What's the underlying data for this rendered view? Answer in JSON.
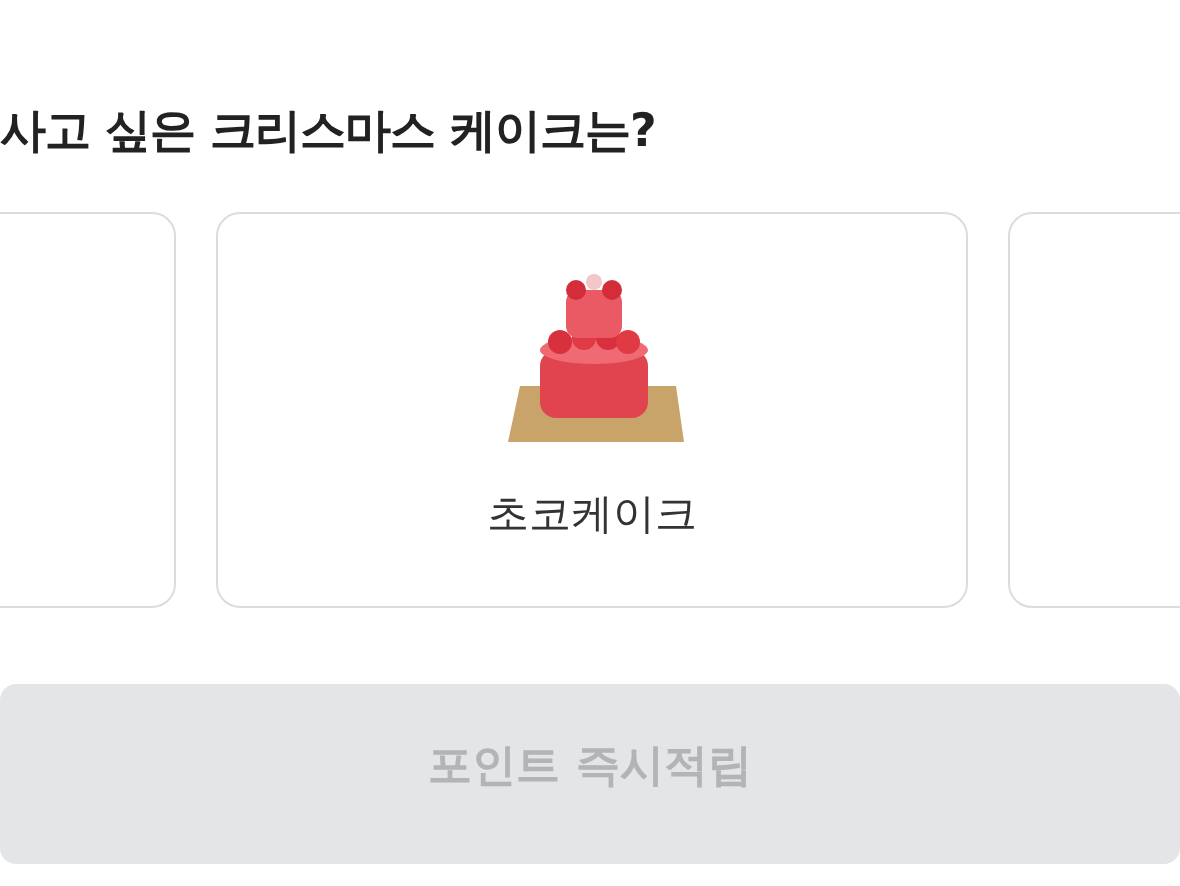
{
  "question": {
    "title": "사고 싶은 크리스마스 케이크는?"
  },
  "options": [
    {
      "kind": "cut"
    },
    {
      "kind": "item",
      "label": "초코케이크"
    },
    {
      "kind": "cut"
    }
  ],
  "submit_button": {
    "label": "포인트 즉시적립",
    "disabled": true
  }
}
